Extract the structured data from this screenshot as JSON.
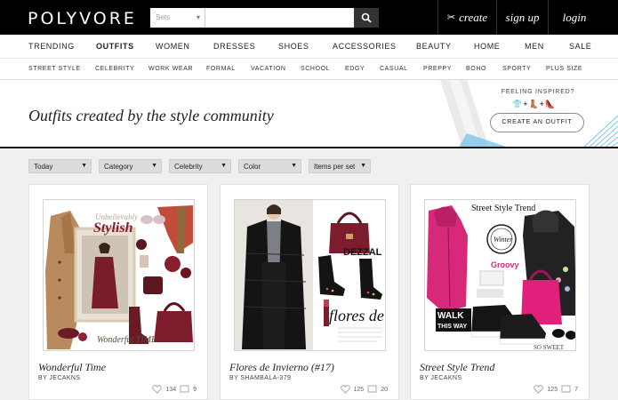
{
  "header": {
    "logo": "POLYVORE",
    "search_select": "Sets",
    "search_placeholder": "",
    "actions": {
      "create": "create",
      "signup": "sign up",
      "login": "login"
    }
  },
  "main_nav": [
    "TRENDING",
    "OUTFITS",
    "WOMEN",
    "DRESSES",
    "SHOES",
    "ACCESSORIES",
    "BEAUTY",
    "HOME",
    "MEN",
    "SALE"
  ],
  "active_nav": "OUTFITS",
  "sub_nav": [
    "STREET STYLE",
    "CELEBRITY",
    "WORK WEAR",
    "FORMAL",
    "VACATION",
    "SCHOOL",
    "EDGY",
    "CASUAL",
    "PREPPY",
    "BOHO",
    "SPORTY",
    "PLUS SIZE"
  ],
  "hero": {
    "title": "Outfits created by the style community",
    "inspired": "FEELING INSPIRED?",
    "inspired_icons": "👕+👢+👠",
    "cta": "CREATE AN OUTFIT"
  },
  "filters": [
    "Today",
    "Category",
    "Celebrity",
    "Color",
    "Items per set"
  ],
  "cards": [
    {
      "title": "Wonderful Time",
      "author": "BY JECAKNS",
      "likes": "134",
      "comments": "9",
      "overlay_top": "Unbelievably",
      "overlay_main": "Stylish",
      "overlay_bottom": "Wonderful TIME"
    },
    {
      "title": "Flores de Invierno (#17)",
      "author": "BY SHAMBALA-379",
      "likes": "125",
      "comments": "20",
      "overlay_brand": "DEZZAL",
      "overlay_main": "flores de invierno"
    },
    {
      "title": "Street Style Trend",
      "author": "BY JECAKNS",
      "likes": "125",
      "comments": "7",
      "overlay_top": "Street Style Trend",
      "overlay_badge": "Winter",
      "overlay_brand": "Groovy",
      "overlay_walk1": "WALK",
      "overlay_walk2": "THIS WAY",
      "overlay_sweet": "SO SWEET"
    }
  ],
  "colors": {
    "topbar": "#000000",
    "accent_blue": "#7ec4e8",
    "burgundy": "#7a1d2a",
    "magenta": "#d8287a"
  }
}
